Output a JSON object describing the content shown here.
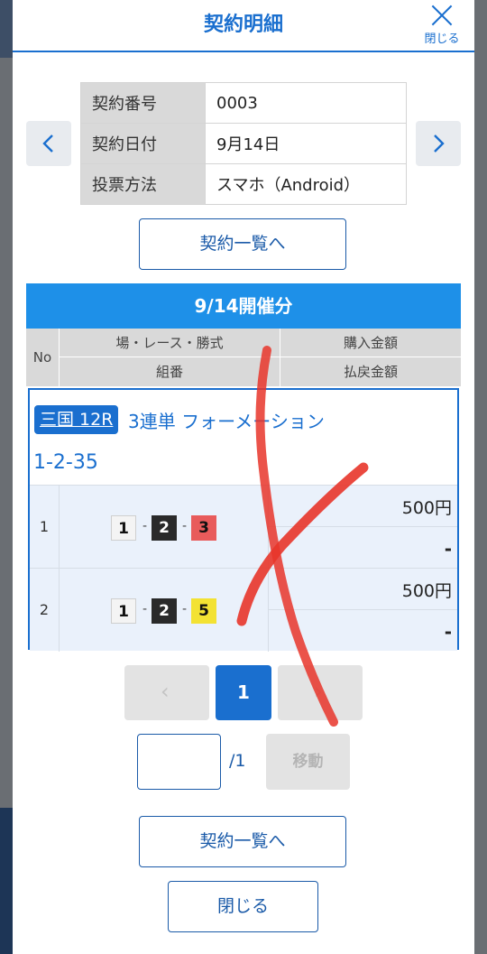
{
  "header": {
    "title": "契約明細",
    "close_label": "閉じる"
  },
  "contract": {
    "rows": [
      {
        "key": "契約番号",
        "value": "0003"
      },
      {
        "key": "契約日付",
        "value": "9月14日"
      },
      {
        "key": "投票方法",
        "value": "スマホ（Android）"
      }
    ]
  },
  "buttons": {
    "list_top": "契約一覧へ",
    "list_bottom": "契約一覧へ",
    "close_bottom": "閉じる"
  },
  "session": {
    "label": "9/14開催分"
  },
  "grid_header": {
    "no": "No",
    "venue_race_type": "場・レース・勝式",
    "purchase_amount": "購入金額",
    "combination": "組番",
    "payout_amount": "払戻金額"
  },
  "bet": {
    "venue_race": "三国 12R",
    "bet_type": "3連単 フォーメーション",
    "combination": "1-2-35",
    "rows": [
      {
        "no": "1",
        "picks": [
          "1",
          "2",
          "3"
        ],
        "amount": "500円",
        "payout": "-"
      },
      {
        "no": "2",
        "picks": [
          "1",
          "2",
          "5"
        ],
        "amount": "500円",
        "payout": "-"
      }
    ],
    "chip_colors": {
      "1": "#f4f4f4",
      "2": "#2a2a2a",
      "3": "#e85b5b",
      "5": "#f3e233"
    }
  },
  "pager": {
    "prev_glyph": "‹",
    "current": "1",
    "next_glyph": "›",
    "input_value": "",
    "total": "/1",
    "move_label": "移動"
  },
  "colors": {
    "accent": "#1a6fcf",
    "session_bar": "#1e90e8",
    "scribble": "#e8352a"
  }
}
